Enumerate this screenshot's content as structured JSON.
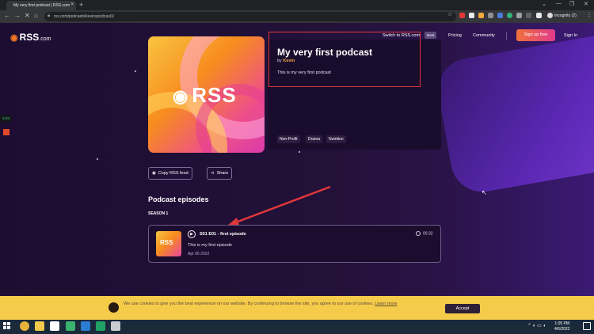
{
  "browser": {
    "tab_title": "My very first podcast | RSS.com",
    "tab_close": "×",
    "new_tab": "+",
    "url": "rss.com/podcasts/kevinspodcast1/",
    "profile_label": "Incognito (2)",
    "window_controls": [
      "⌄",
      "—",
      "❐",
      "✕"
    ],
    "nav": {
      "back": "←",
      "forward": "→",
      "reload": "✕",
      "home": "⌂"
    },
    "menu": "⋮"
  },
  "site": {
    "logo_main": "RSS",
    "logo_suffix": ".com",
    "nav": {
      "switch_label": "Switch to RSS.com",
      "switch_badge": "Next",
      "pricing": "Pricing",
      "community": "Community",
      "signup": "Sign up free",
      "signin": "Sign In"
    }
  },
  "podcast": {
    "cover_text": "RSS",
    "title": "My very first podcast",
    "by_prefix": "by",
    "author": "Kevin",
    "description": "This is my very first podcast",
    "tags": [
      "Non-Profit",
      "Drama",
      "Nutrition"
    ],
    "actions": {
      "copy_feed": "Copy RSS feed",
      "share": "Share"
    }
  },
  "episodes": {
    "heading": "Podcast episodes",
    "season_label": "SEASON 1",
    "items": [
      {
        "thumb_text": "RSS",
        "title": "S01 E01 - first episode",
        "description": "This is my first episode",
        "date": "Apr 06 2022",
        "duration": "00:32"
      }
    ]
  },
  "recorder": {
    "time": "5:03"
  },
  "cookie": {
    "text": "We use cookies to give you the best experience on our website. By continuing to browse the site, you agree to our use of cookies.",
    "learn_more": "Learn more",
    "accept": "Accept"
  },
  "taskbar": {
    "time": "1:05 PM",
    "date": "4/6/2022"
  },
  "colors": {
    "accent_orange": "#f37a21",
    "signup_gradient_start": "#f0723a",
    "signup_gradient_end": "#e23a8c",
    "highlight_red": "#e0383a",
    "cookie_bar": "#f5cb4a"
  }
}
